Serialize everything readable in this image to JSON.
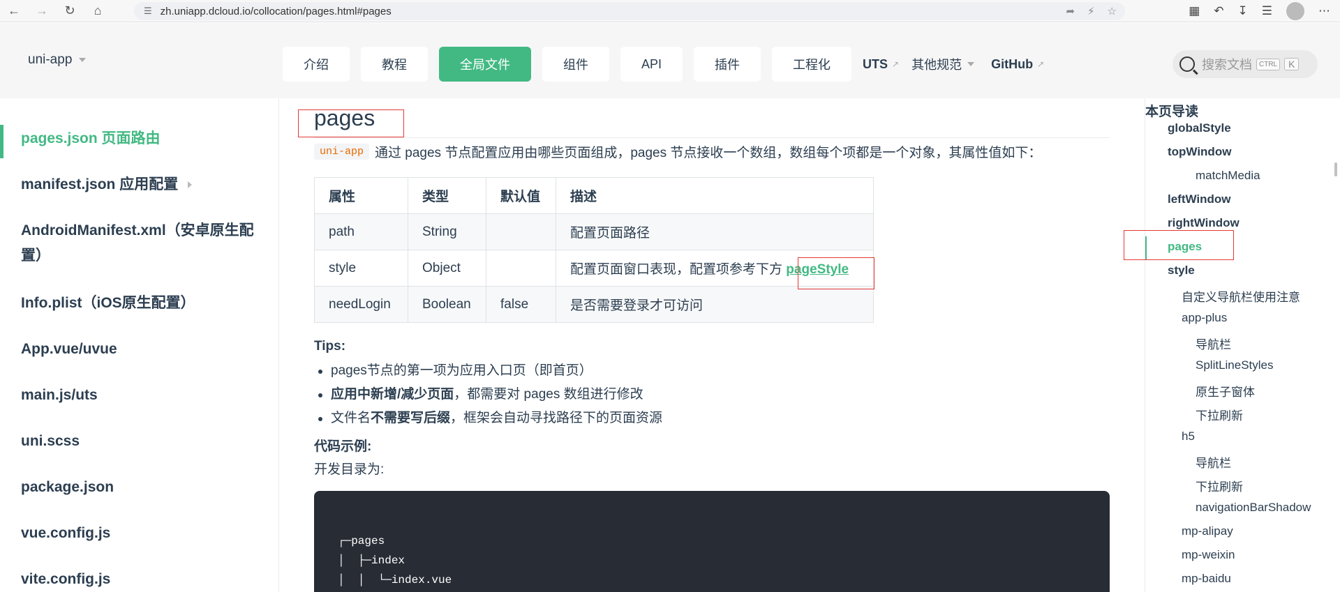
{
  "browser": {
    "url": "zh.uniapp.dcloud.io/collocation/pages.html#pages"
  },
  "header": {
    "brand": "uni-app",
    "nav": [
      {
        "label": "介绍"
      },
      {
        "label": "教程"
      },
      {
        "label": "全局文件"
      },
      {
        "label": "组件"
      },
      {
        "label": "API"
      },
      {
        "label": "插件"
      },
      {
        "label": "工程化"
      }
    ],
    "links": {
      "uts": "UTS",
      "other": "其他规范",
      "github": "GitHub"
    },
    "search": {
      "placeholder": "搜索文档",
      "kbd_ctrl": "CTRL",
      "kbd_k": "K"
    }
  },
  "sidebar": {
    "items": [
      "pages.json 页面路由",
      "manifest.json 应用配置",
      "AndroidManifest.xml（安卓原生配置）",
      "Info.plist（iOS原生配置）",
      "App.vue/uvue",
      "main.js/uts",
      "uni.scss",
      "package.json",
      "vue.config.js",
      "vite.config.js"
    ]
  },
  "main": {
    "heading": "pages",
    "intro_tag": "uni-app",
    "intro_text": "通过 pages 节点配置应用由哪些页面组成，pages 节点接收一个数组，数组每个项都是一个对象，其属性值如下：",
    "table": {
      "headers": [
        "属性",
        "类型",
        "默认值",
        "描述"
      ],
      "rows": [
        {
          "prop": "path",
          "type": "String",
          "default": "",
          "desc": "配置页面路径"
        },
        {
          "prop": "style",
          "type": "Object",
          "default": "",
          "desc": "配置页面窗口表现，配置项参考下方",
          "link": "pageStyle"
        },
        {
          "prop": "needLogin",
          "type": "Boolean",
          "default": "false",
          "desc": "是否需要登录才可访问"
        }
      ]
    },
    "tips_title": "Tips:",
    "tips": {
      "t1": "pages节点的第一项为应用入口页（即首页）",
      "t2_bold": "应用中新增/减少页面",
      "t2_rest": "，都需要对 pages 数组进行修改",
      "t3_pre": "文件名",
      "t3_bold": "不需要写后缀",
      "t3_rest": "，框架会自动寻找路径下的页面资源"
    },
    "code_example": "代码示例:",
    "dev_dir": "开发目录为:",
    "code_lines": [
      "┌─pages",
      "│  ├─index",
      "│  │  └─index.vue"
    ]
  },
  "toc": {
    "title": "本页导读",
    "items": [
      {
        "label": "globalStyle"
      },
      {
        "label": "topWindow"
      },
      {
        "label": "matchMedia"
      },
      {
        "label": "leftWindow"
      },
      {
        "label": "rightWindow"
      },
      {
        "label": "pages"
      },
      {
        "label": "style"
      },
      {
        "label": "自定义导航栏使用注意"
      },
      {
        "label": "app-plus"
      },
      {
        "label": "导航栏"
      },
      {
        "label": "SplitLineStyles"
      },
      {
        "label": "原生子窗体"
      },
      {
        "label": "下拉刷新"
      },
      {
        "label": "h5"
      },
      {
        "label": "导航栏"
      },
      {
        "label": "下拉刷新"
      },
      {
        "label": "navigationBarShadow"
      },
      {
        "label": "mp-alipay"
      },
      {
        "label": "mp-weixin"
      },
      {
        "label": "mp-baidu"
      }
    ]
  },
  "colors": {
    "accent": "#42b983",
    "text": "#2c3e50",
    "highlight_box": "#e53935"
  }
}
